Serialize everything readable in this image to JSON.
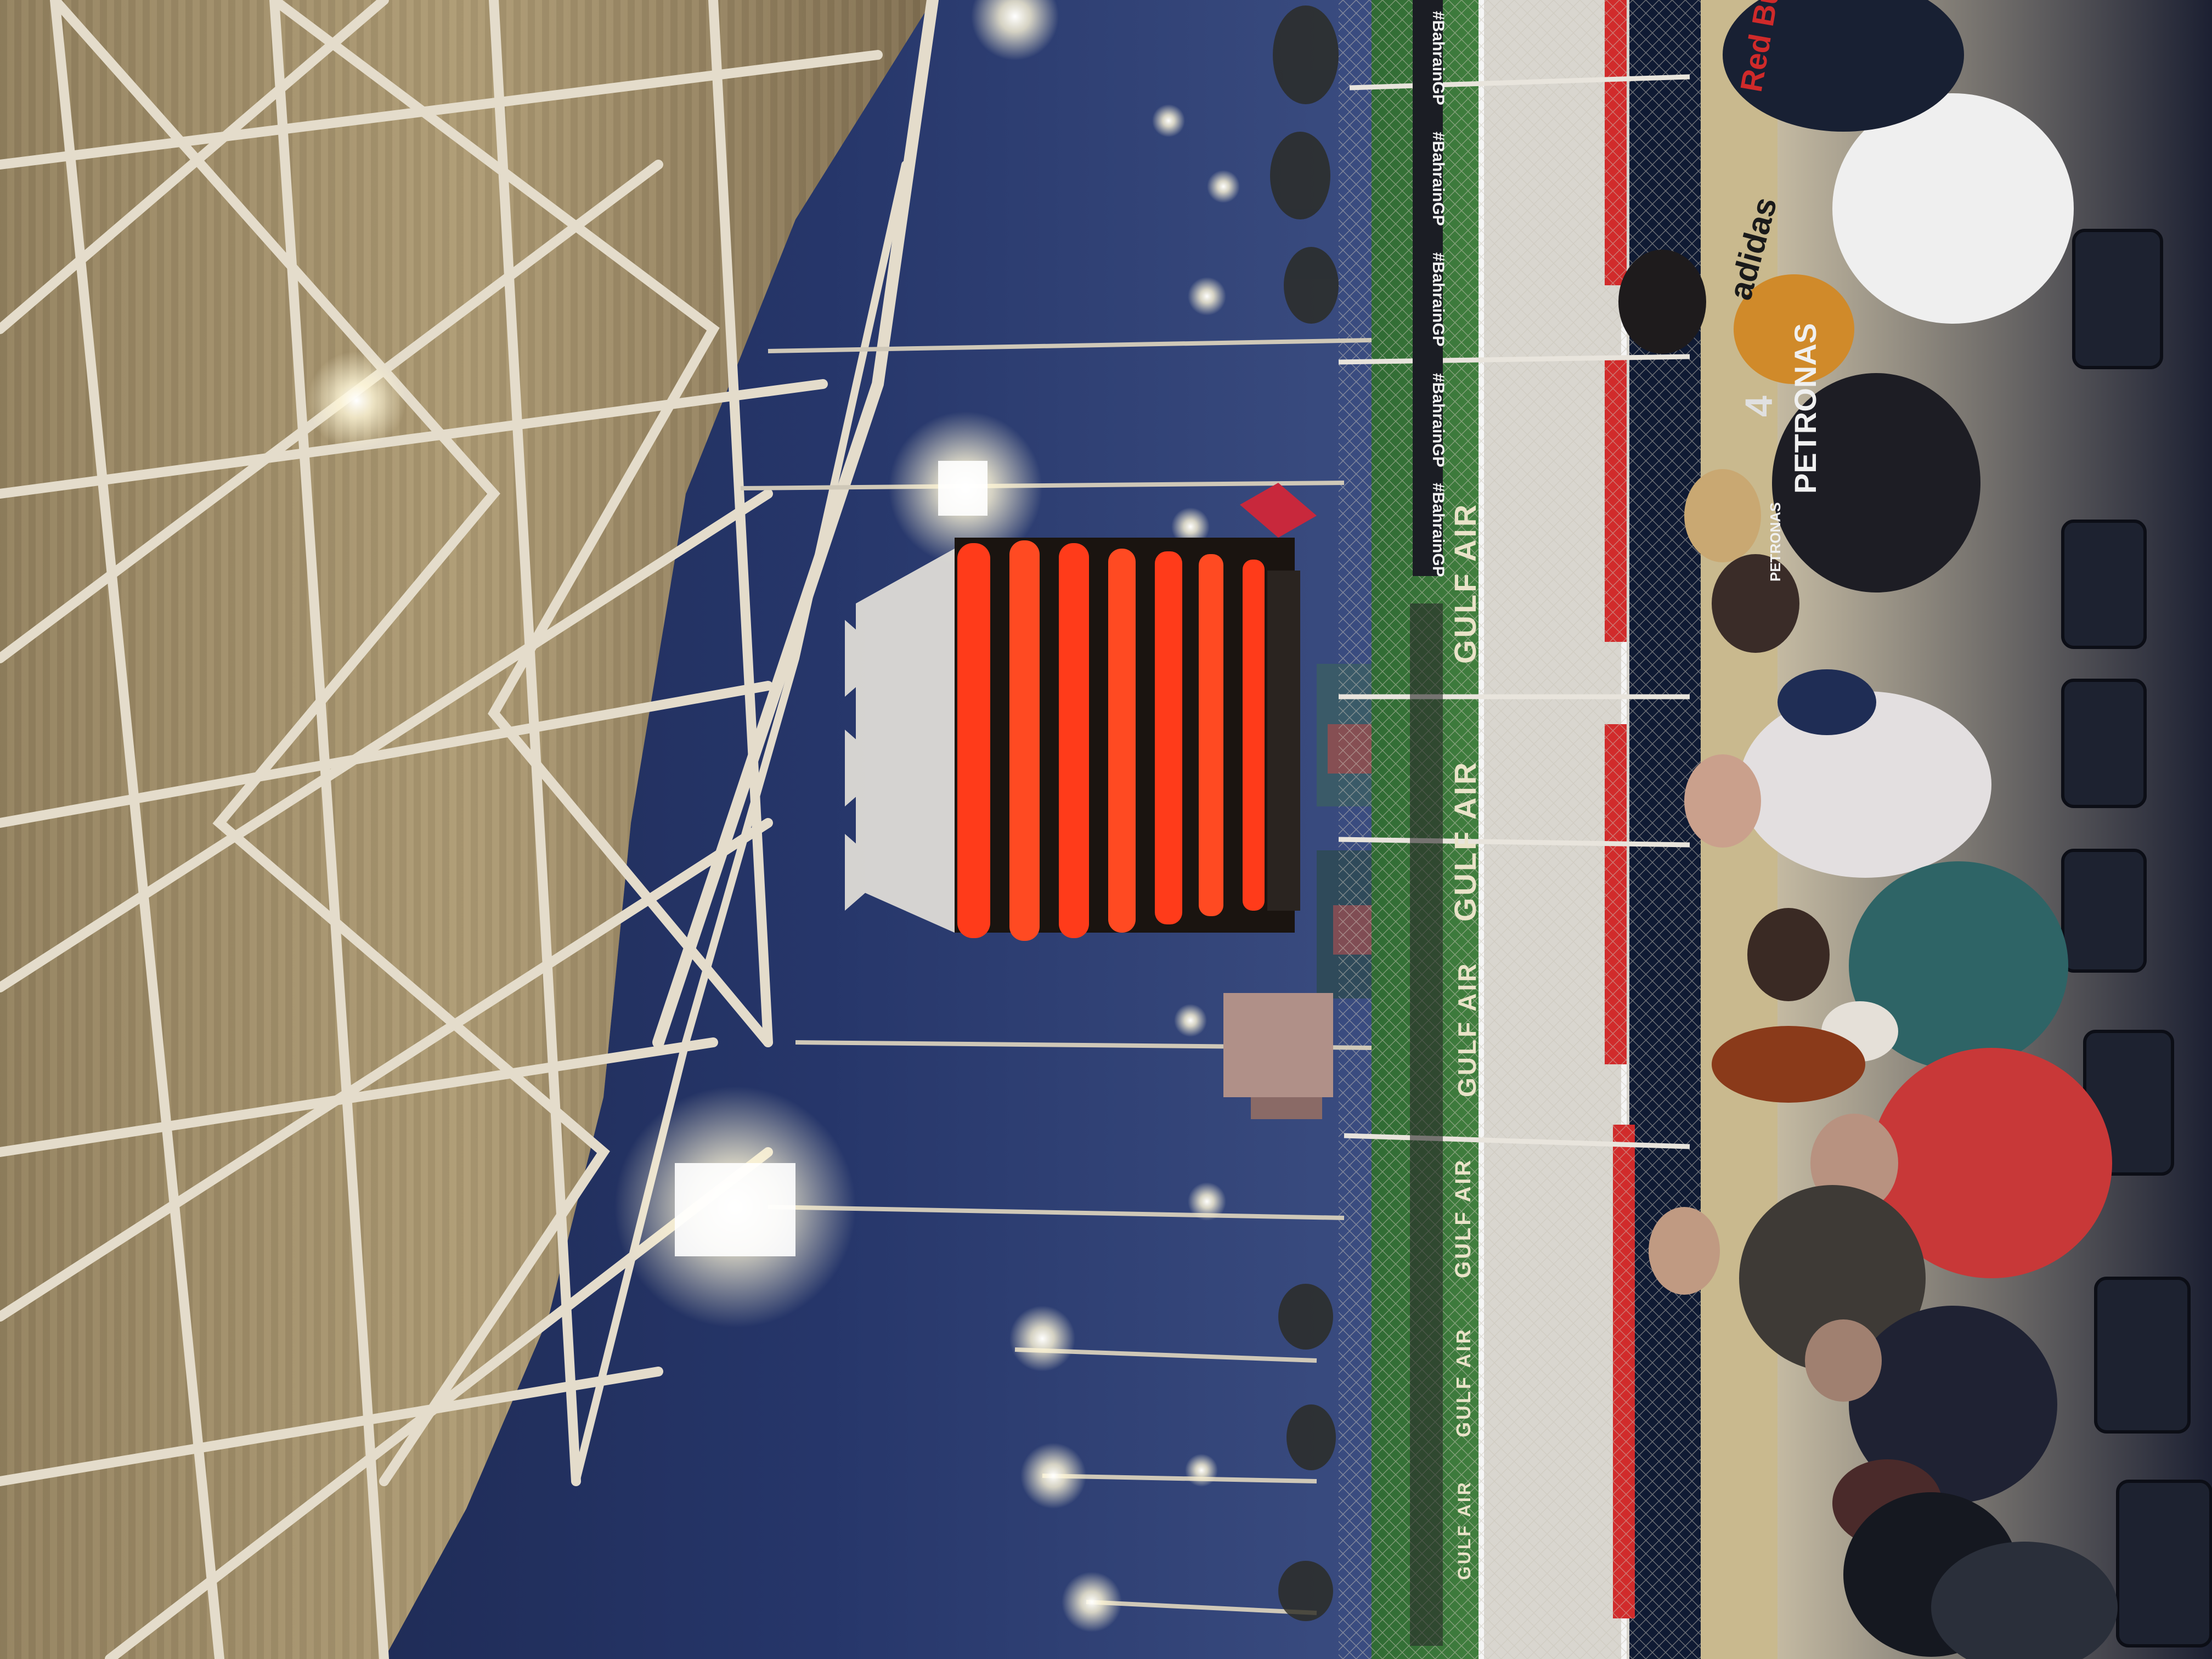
{
  "photo": {
    "orientation": "rotated 90deg clockwise (sky on left, track and crowd on right)",
    "setting": "night race, floodlit grandstand view"
  },
  "signage": {
    "trackside_boards": [
      "#BahrainGP",
      "#BahrainGP",
      "#BahrainGP",
      "#BahrainGP",
      "#BahrainGP"
    ],
    "gulf_air_banners": [
      "GULF AIR",
      "GULF AIR",
      "GULF AIR",
      "GULF AIR",
      "GULF AIR",
      "GULF AIR"
    ]
  },
  "apparel": {
    "shirt_1": "adidas",
    "shirt_2": "PETRONAS",
    "shirt_2b": "PETRONAS",
    "cap_1": "Red Bull",
    "shirt_number": "4"
  },
  "colors": {
    "sky": "#1e2c55",
    "tower_glow": "#ff3b1a",
    "roof_steel": "#d8cdb4",
    "grass": "#3c7a3a",
    "track": "#d9d6cf",
    "kerb_red": "#d12b2b"
  }
}
